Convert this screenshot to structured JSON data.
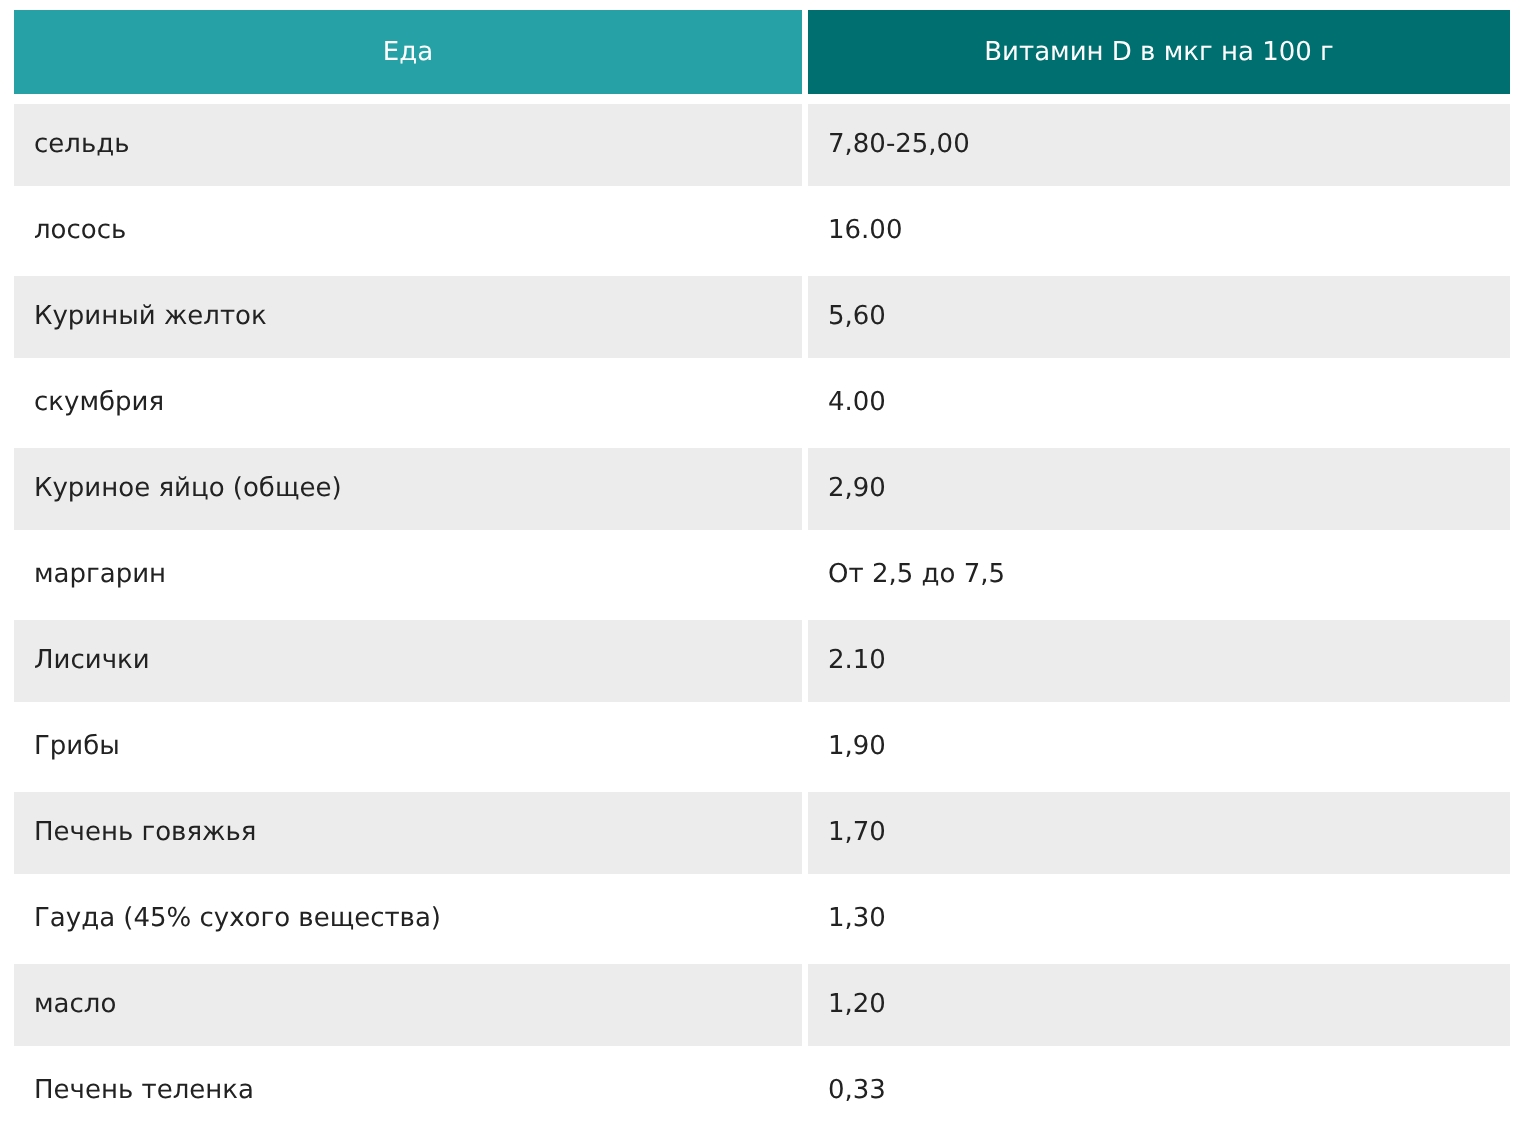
{
  "table": {
    "columns": [
      "Еда",
      "Витамин D в мкг на 100 г"
    ],
    "rows": [
      [
        "сельдь",
        "7,80-25,00"
      ],
      [
        "лосось",
        "16.00"
      ],
      [
        "Куриный желток",
        "5,60"
      ],
      [
        "скумбрия",
        "4.00"
      ],
      [
        "Куриное яйцо (общее)",
        "2,90"
      ],
      [
        "маргарин",
        "От 2,5 до 7,5"
      ],
      [
        "Лисички",
        "2.10"
      ],
      [
        "Грибы",
        "1,90"
      ],
      [
        "Печень говяжья",
        "1,70"
      ],
      [
        "Гауда (45% сухого вещества)",
        "1,30"
      ],
      [
        "масло",
        "1,20"
      ],
      [
        "Печень теленка",
        "0,33"
      ]
    ]
  }
}
